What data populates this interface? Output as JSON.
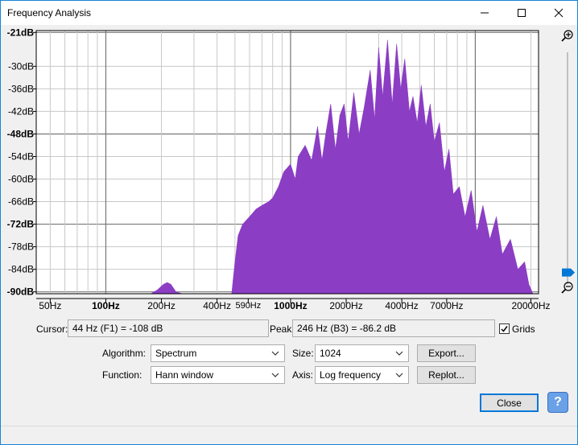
{
  "window": {
    "title": "Frequency Analysis"
  },
  "chart_data": {
    "type": "area",
    "ylabels": [
      "-21dB",
      "-30dB",
      "-36dB",
      "-42dB",
      "-48dB",
      "-54dB",
      "-60dB",
      "-66dB",
      "-72dB",
      "-78dB",
      "-84dB",
      "-90dB"
    ],
    "xlabels": [
      "50Hz",
      "100Hz",
      "200Hz",
      "400Hz",
      "590Hz",
      "1000Hz",
      "2000Hz",
      "4000Hz",
      "7000Hz",
      "20000Hz"
    ],
    "bold_ylabels": [
      "-21dB",
      "-48dB",
      "-72dB",
      "-90dB"
    ],
    "bold_xlabels": [
      "100Hz",
      "1000Hz"
    ],
    "ylim": [
      -90.5,
      -20.5
    ],
    "xlim": [
      42,
      22000
    ],
    "scale_x": "log",
    "grid": true,
    "color": "#8b3dc4",
    "series": [
      {
        "points": [
          [
            42,
            -90.5
          ],
          [
            175,
            -90.5
          ],
          [
            190,
            -89.5
          ],
          [
            205,
            -88
          ],
          [
            215,
            -87.5
          ],
          [
            225,
            -88
          ],
          [
            240,
            -90
          ],
          [
            260,
            -90.5
          ],
          [
            480,
            -90.5
          ],
          [
            500,
            -82
          ],
          [
            520,
            -75
          ],
          [
            550,
            -72
          ],
          [
            600,
            -70
          ],
          [
            650,
            -68
          ],
          [
            700,
            -67
          ],
          [
            760,
            -66
          ],
          [
            800,
            -65
          ],
          [
            860,
            -62
          ],
          [
            920,
            -58
          ],
          [
            960,
            -57
          ],
          [
            1000,
            -56
          ],
          [
            1060,
            -60
          ],
          [
            1100,
            -54
          ],
          [
            1200,
            -51
          ],
          [
            1300,
            -55
          ],
          [
            1400,
            -46
          ],
          [
            1480,
            -55
          ],
          [
            1550,
            -48
          ],
          [
            1650,
            -40
          ],
          [
            1750,
            -52
          ],
          [
            1850,
            -43
          ],
          [
            1950,
            -40
          ],
          [
            2050,
            -50
          ],
          [
            2200,
            -37
          ],
          [
            2350,
            -48
          ],
          [
            2500,
            -41
          ],
          [
            2700,
            -31
          ],
          [
            2850,
            -44
          ],
          [
            3000,
            -25
          ],
          [
            3150,
            -38
          ],
          [
            3350,
            -23
          ],
          [
            3550,
            -40
          ],
          [
            3750,
            -24
          ],
          [
            3950,
            -36
          ],
          [
            4150,
            -28
          ],
          [
            4400,
            -42
          ],
          [
            4600,
            -38
          ],
          [
            4850,
            -45
          ],
          [
            5100,
            -35
          ],
          [
            5400,
            -46
          ],
          [
            5700,
            -40
          ],
          [
            6000,
            -50
          ],
          [
            6400,
            -45
          ],
          [
            6800,
            -58
          ],
          [
            7200,
            -52
          ],
          [
            7600,
            -64
          ],
          [
            8200,
            -62
          ],
          [
            8800,
            -70
          ],
          [
            9500,
            -63
          ],
          [
            10200,
            -74
          ],
          [
            11000,
            -67
          ],
          [
            12000,
            -76
          ],
          [
            13000,
            -70
          ],
          [
            14000,
            -80
          ],
          [
            15500,
            -76
          ],
          [
            17000,
            -84
          ],
          [
            18500,
            -82
          ],
          [
            19500,
            -88
          ],
          [
            20500,
            -90.5
          ],
          [
            22000,
            -90.5
          ]
        ]
      }
    ]
  },
  "readouts": {
    "cursor_label": "Cursor:",
    "cursor_value": "44 Hz (F1) = -108 dB",
    "peak_label": "Peak:",
    "peak_value": "246 Hz (B3) = -86.2 dB",
    "grids_label": "Grids",
    "grids_checked": true
  },
  "controls": {
    "algorithm_label": "Algorithm:",
    "algorithm_value": "Spectrum",
    "size_label": "Size:",
    "size_value": "1024",
    "function_label": "Function:",
    "function_value": "Hann window",
    "axis_label": "Axis:",
    "axis_value": "Log frequency",
    "export_label": "Export...",
    "replot_label": "Replot...",
    "close_label": "Close",
    "help_label": "?"
  },
  "zoom": {
    "level": 0.95
  }
}
